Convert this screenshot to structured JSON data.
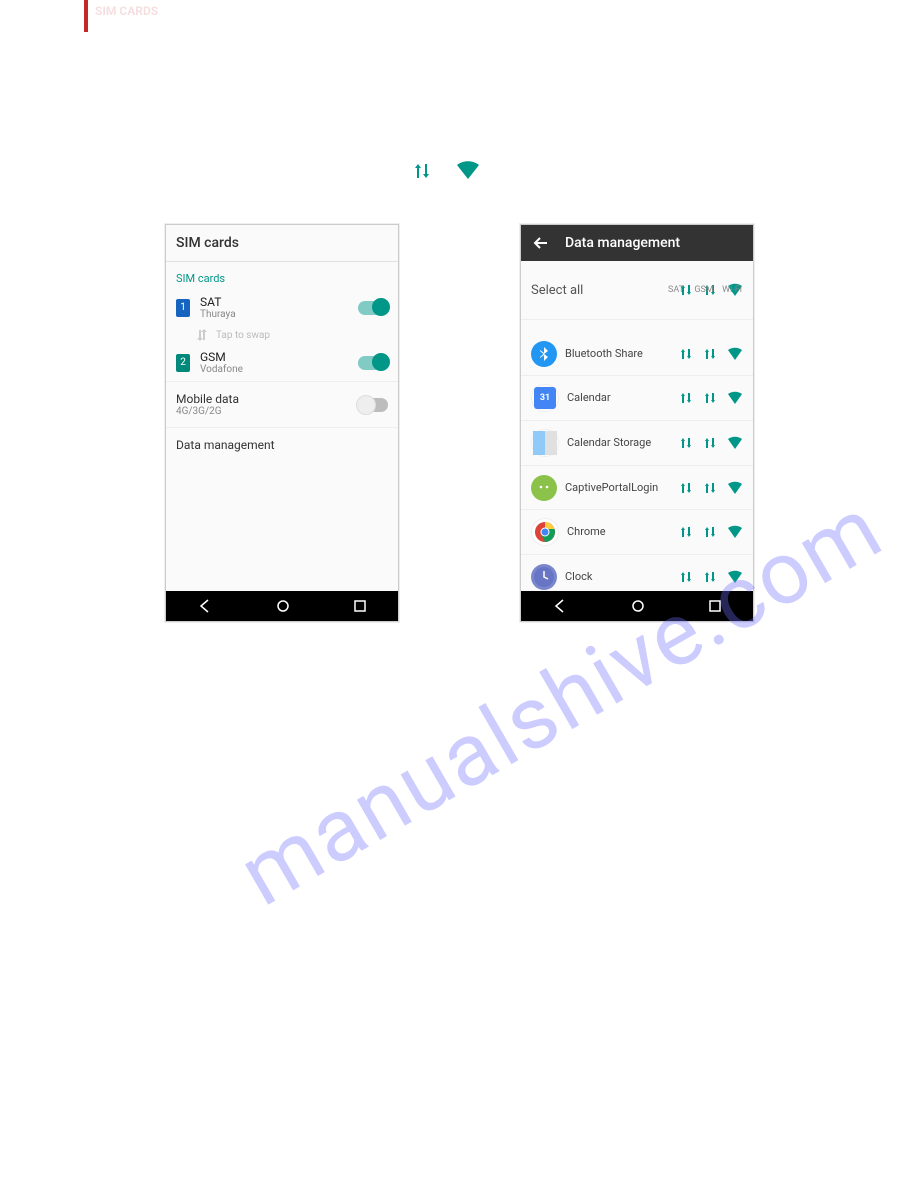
{
  "header_faint": "SIM CARDS",
  "watermark": "manualshive.com",
  "left_phone": {
    "title": "SIM cards",
    "section": "SIM cards",
    "sim1": {
      "badge": "1",
      "name": "SAT",
      "sub": "Thuraya"
    },
    "swap": "Tap to swap",
    "sim2": {
      "badge": "2",
      "name": "GSM",
      "sub": "Vodafone"
    },
    "mobile_data": {
      "title": "Mobile data",
      "sub": "4G/3G/2G"
    },
    "data_mgmt": "Data management"
  },
  "right_phone": {
    "title": "Data management",
    "select_all": "Select all",
    "col_labels": [
      "SAT",
      "GSM",
      "Wi-Fi"
    ],
    "apps": [
      {
        "name": "Bluetooth Share",
        "iconBg": "#2196f3"
      },
      {
        "name": "Calendar",
        "iconBg": "#ffffff"
      },
      {
        "name": "Calendar Storage",
        "iconBg": "#ffffff"
      },
      {
        "name": "CaptivePortalLogin",
        "iconBg": "#8bc34a"
      },
      {
        "name": "Chrome",
        "iconBg": "#ffffff"
      },
      {
        "name": "Clock",
        "iconBg": "#7986cb"
      }
    ]
  }
}
